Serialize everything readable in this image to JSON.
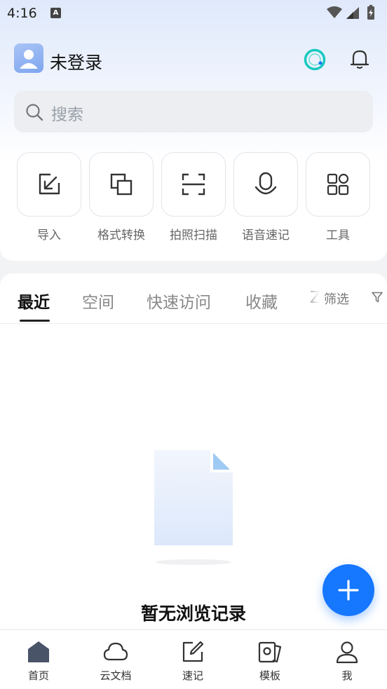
{
  "status_bar": {
    "time": "4:16",
    "badge": "A"
  },
  "header": {
    "username": "未登录"
  },
  "search": {
    "placeholder": "搜索"
  },
  "quick_actions": [
    {
      "label": "导入",
      "icon": "import-icon"
    },
    {
      "label": "格式转换",
      "icon": "format-convert-icon"
    },
    {
      "label": "拍照扫描",
      "icon": "scan-icon"
    },
    {
      "label": "语音速记",
      "icon": "microphone-icon"
    },
    {
      "label": "工具",
      "icon": "grid-tools-icon"
    }
  ],
  "tabs": [
    {
      "label": "最近",
      "active": true
    },
    {
      "label": "空间"
    },
    {
      "label": "快速访问"
    },
    {
      "label": "收藏"
    },
    {
      "label": "Z"
    }
  ],
  "filter": {
    "label": "筛选",
    "icon": "funnel-icon"
  },
  "empty_state": {
    "text": "暂无浏览记录"
  },
  "fab": {
    "icon": "plus-icon"
  },
  "bottom_nav": [
    {
      "label": "首页",
      "icon": "home-icon",
      "active": true
    },
    {
      "label": "云文档",
      "icon": "cloud-icon"
    },
    {
      "label": "速记",
      "icon": "note-edit-icon"
    },
    {
      "label": "模板",
      "icon": "template-icon"
    },
    {
      "label": "我",
      "icon": "person-icon"
    }
  ],
  "colors": {
    "accent": "#1677ff",
    "ai_ring": "#18c9c0"
  }
}
